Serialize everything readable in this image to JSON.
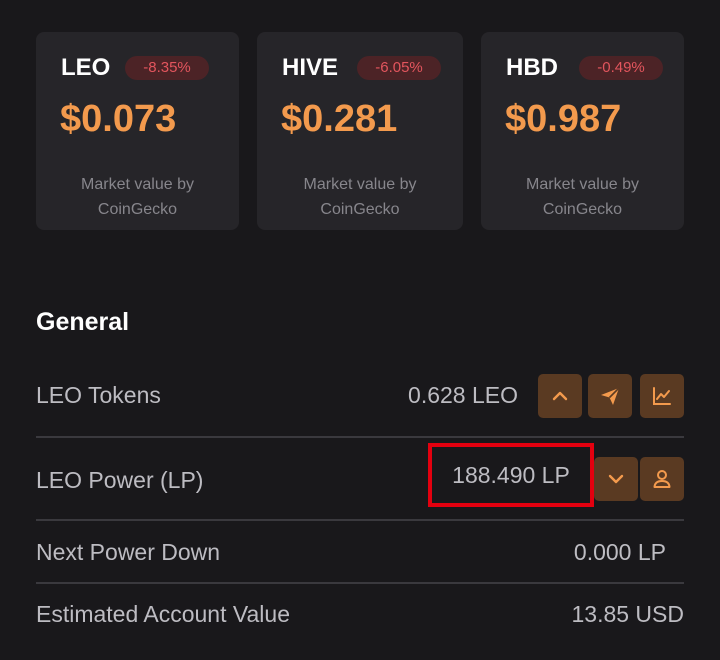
{
  "tickers": [
    {
      "symbol": "LEO",
      "change": "-8.35%",
      "price": "$0.073",
      "note": "Market value by CoinGecko"
    },
    {
      "symbol": "HIVE",
      "change": "-6.05%",
      "price": "$0.281",
      "note": "Market value by CoinGecko"
    },
    {
      "symbol": "HBD",
      "change": "-0.49%",
      "price": "$0.987",
      "note": "Market value by CoinGecko"
    }
  ],
  "general": {
    "title": "General",
    "rows": [
      {
        "label": "LEO Tokens",
        "value": "0.628 LEO"
      },
      {
        "label": "LEO Power (LP)",
        "value": "188.490 LP"
      },
      {
        "label": "Next Power Down",
        "value": "0.000 LP"
      },
      {
        "label": "Estimated Account Value",
        "value": "13.85 USD"
      }
    ]
  },
  "icons": {
    "tokens_actions": [
      "chevron-up-icon",
      "send-icon",
      "chart-icon"
    ],
    "power_actions": [
      "chevron-down-icon",
      "user-icon"
    ]
  },
  "colors": {
    "background": "#19181b",
    "card": "#262529",
    "price": "#f39a4d",
    "negative": "#e2555d",
    "button": "#5a3a22",
    "highlight": "#e3000f"
  }
}
